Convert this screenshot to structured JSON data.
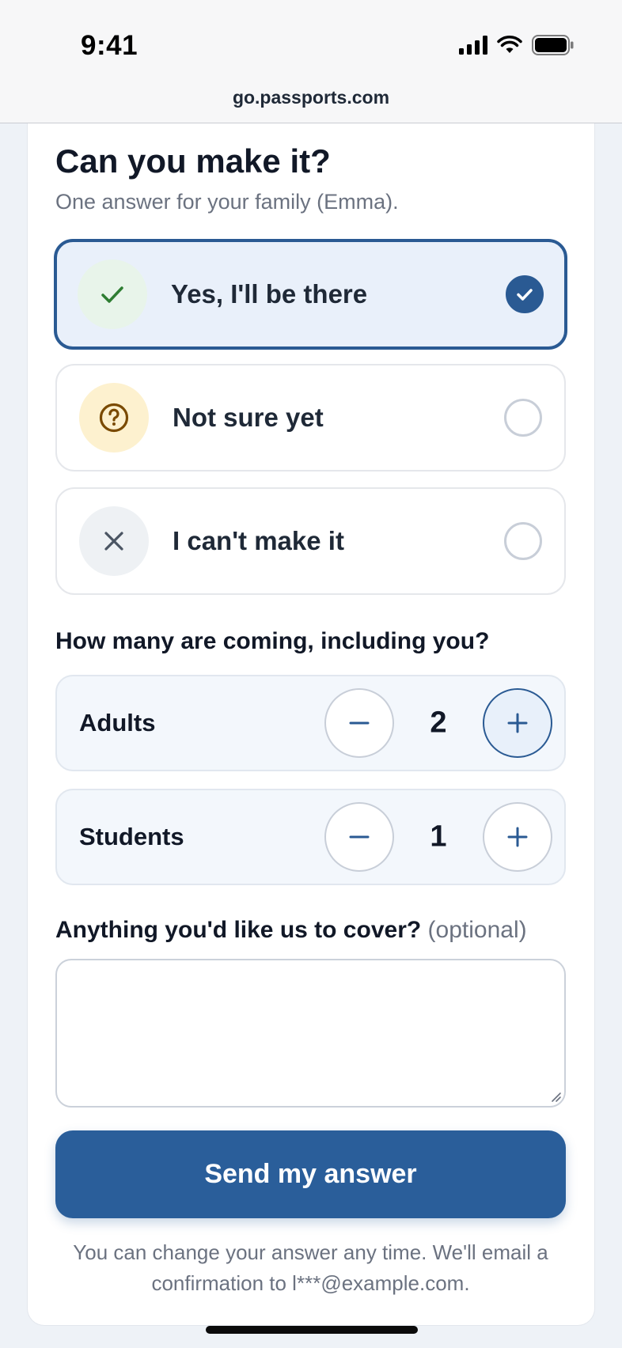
{
  "status_bar": {
    "time": "9:41"
  },
  "url_bar": {
    "url": "go.passports.com"
  },
  "form": {
    "heading": "Can you make it?",
    "subheading": "One answer for your family (Emma).",
    "options": [
      {
        "label": "Yes, I'll be there",
        "selected": true,
        "icon": "check-icon",
        "icon_bg": "#e8f4ea",
        "icon_color": "#2e7d32"
      },
      {
        "label": "Not sure yet",
        "selected": false,
        "icon": "question-circle-icon",
        "icon_bg": "#fdf1cf",
        "icon_color": "#7a4a00"
      },
      {
        "label": "I can't make it",
        "selected": false,
        "icon": "x-icon",
        "icon_bg": "#eef1f4",
        "icon_color": "#4b5563"
      }
    ],
    "count_question": "How many are coming, including you?",
    "counters": [
      {
        "label": "Adults",
        "value": "2"
      },
      {
        "label": "Students",
        "value": "1"
      }
    ],
    "notes_question": "Anything you'd like us to cover?",
    "notes_optional": "(optional)",
    "notes_value": "",
    "submit_label": "Send my answer",
    "footnote": "You can change your answer any time. We'll email a confirmation to l***@example.com."
  },
  "colors": {
    "primary": "#2a5e9a",
    "selected_bg": "#e9f0fa",
    "muted_text": "#6b7280"
  }
}
